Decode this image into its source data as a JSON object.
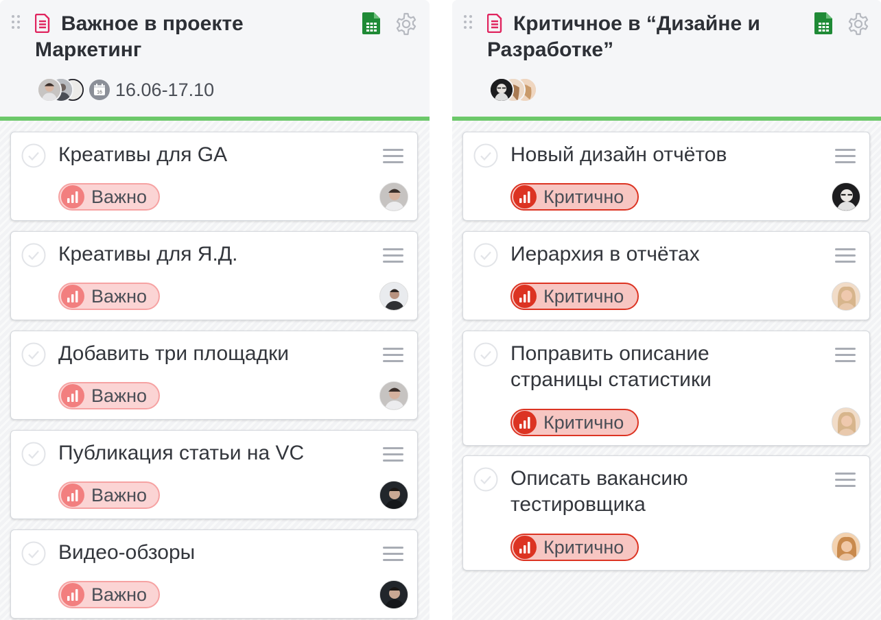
{
  "colors": {
    "accent_green": "#6cc86a",
    "important_bg": "#fbd4d4",
    "important_icon": "#f27f7f",
    "critical_bg": "#f7c6c2",
    "critical_icon": "#dc3322",
    "doc_icon": "#e0245e",
    "sheet_icon": "#1f8a36"
  },
  "columns": [
    {
      "title": "Важное в проекте Маркетинг",
      "date": "16.06-17.10",
      "calendar_day": "16",
      "icons": [
        "drag-handle-icon",
        "document-icon",
        "spreadsheet-icon",
        "gear-icon",
        "calendar-icon"
      ],
      "cards": [
        {
          "title": "Креативы для GA",
          "badge": "Важно"
        },
        {
          "title": "Креативы для Я.Д.",
          "badge": "Важно"
        },
        {
          "title": "Добавить три площадки",
          "badge": "Важно"
        },
        {
          "title": "Публикация статьи на VC",
          "badge": "Важно"
        },
        {
          "title": "Видео-обзоры",
          "badge": "Важно"
        }
      ]
    },
    {
      "title": "Критичное в “Дизайне и Разработке”",
      "icons": [
        "drag-handle-icon",
        "document-icon",
        "spreadsheet-icon",
        "gear-icon"
      ],
      "cards": [
        {
          "title": "Новый дизайн отчётов",
          "badge": "Критично"
        },
        {
          "title": "Иерархия в отчётах",
          "badge": "Критично"
        },
        {
          "title": "Поправить описание страницы статистики",
          "badge": "Критично"
        },
        {
          "title": "Описать вакансию тестировщика",
          "badge": "Критично"
        }
      ]
    }
  ]
}
